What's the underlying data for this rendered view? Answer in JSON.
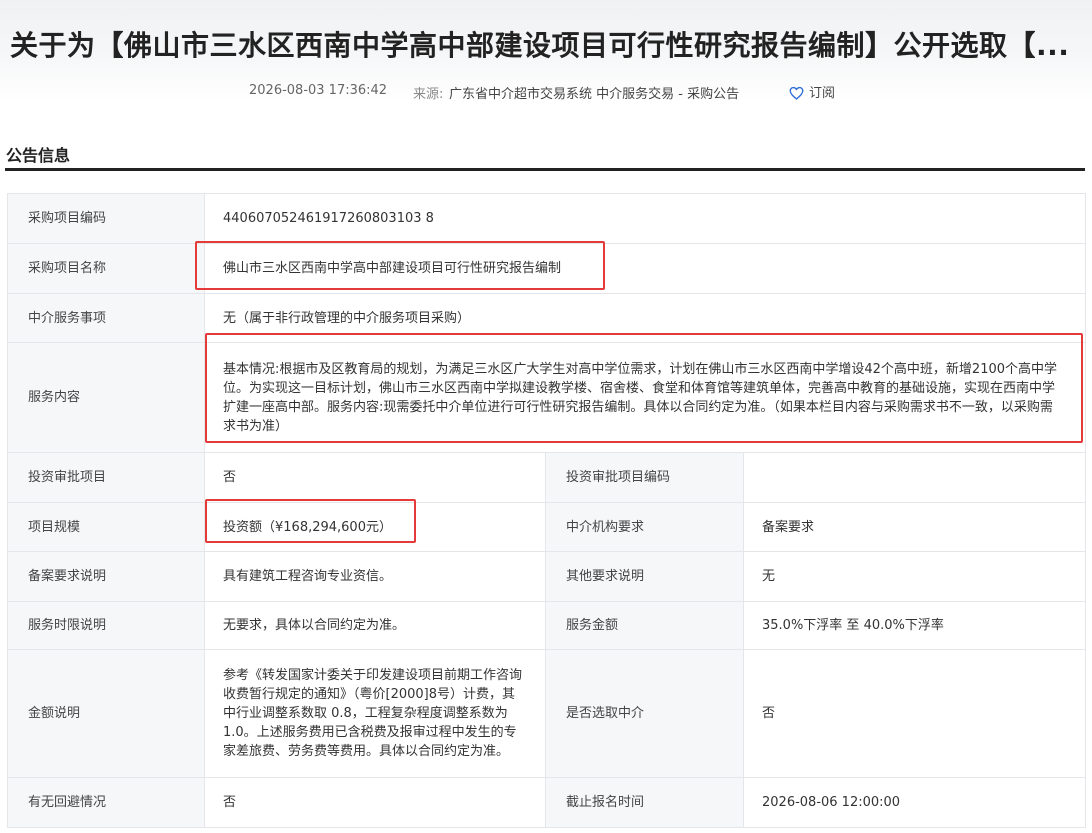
{
  "header": {
    "title": "关于为【佛山市三水区西南中学高中部建设项目可行性研究报告编制】公开选取【...",
    "date": "2026-08-03 17:36:42",
    "source_label": "来源:",
    "source_value": "广东省中介超市交易系统 中介服务交易 - 采购公告",
    "subscribe_label": "订阅",
    "subscribe_icon": "heart-icon"
  },
  "section": {
    "title": "公告信息"
  },
  "table": {
    "project_code_label": "采购项目编码",
    "project_code": "440607052461917260803103 8",
    "project_name_label": "采购项目名称",
    "project_name": "佛山市三水区西南中学高中部建设项目可行性研究报告编制",
    "service_item_label": "中介服务事项",
    "service_item": "无（属于非行政管理的中介服务项目采购）",
    "service_content_label": "服务内容",
    "service_content": "基本情况:根据市及区教育局的规划，为满足三水区广大学生对高中学位需求，计划在佛山市三水区西南中学增设42个高中班，新增2100个高中学位。为实现这一目标计划，佛山市三水区西南中学拟建设教学楼、宿舍楼、食堂和体育馆等建筑单体，完善高中教育的基础设施，实现在西南中学扩建一座高中部。服务内容:现需委托中介单位进行可行性研究报告编制。具体以合同约定为准。（如果本栏目内容与采购需求书不一致，以采购需求书为准）",
    "investment_approval_label": "投资审批项目",
    "investment_approval": "否",
    "investment_code_label": "投资审批项目编码",
    "investment_code": "",
    "project_scale_label": "项目规模",
    "project_scale": "投资额（¥168,294,600元）",
    "agency_requirement_label": "中介机构要求",
    "agency_requirement": "备案要求",
    "filing_note_label": "备案要求说明",
    "filing_note": "具有建筑工程咨询专业资信。",
    "other_note_label": "其他要求说明",
    "other_note": "无",
    "service_period_label": "服务时限说明",
    "service_period": "无要求，具体以合同约定为准。",
    "service_amount_label": "服务金额",
    "service_amount": "35.0%下浮率 至 40.0%下浮率",
    "amount_note_label": "金额说明",
    "amount_note": "参考《转发国家计委关于印发建设项目前期工作咨询收费暂行规定的通知》（粤价[2000]8号）计费，其中行业调整系数取 0.8，工程复杂程度调整系数为1.0。上述服务费用已含税费及报审过程中发生的专家差旅费、劳务费等费用。具体以合同约定为准。",
    "select_agency_label": "是否选取中介",
    "select_agency": "否",
    "avoidance_label": "有无回避情况",
    "avoidance": "否",
    "deadline_label": "截止报名时间",
    "deadline": "2026-08-06 12:00:00"
  },
  "colors": {
    "highlight": "#e53a3a",
    "label_bg": "#f6f7f9",
    "border": "#e4e6e9",
    "subscribe_icon": "#2f6fd6"
  }
}
